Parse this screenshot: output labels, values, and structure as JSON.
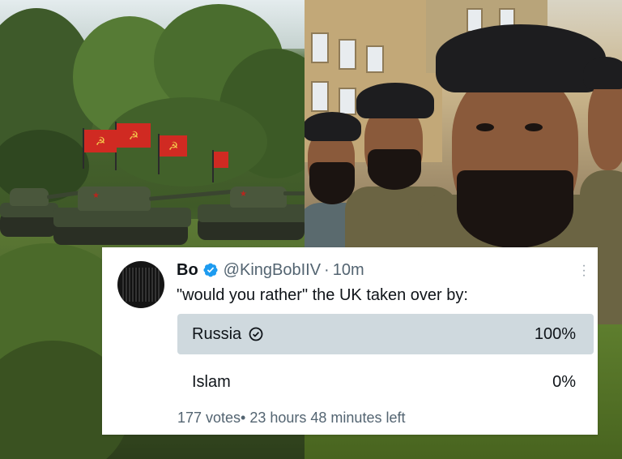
{
  "tweet": {
    "author_name": "Bo",
    "verified_icon": "verified-badge-icon",
    "handle": "@KingBobIIV",
    "separator": "·",
    "time": "10m",
    "text": "\"would you rather\" the UK taken over by:",
    "more_icon": "more-options-icon"
  },
  "poll": {
    "options": [
      {
        "label": "Russia",
        "percent_text": "100%",
        "share": 1.0,
        "winner": true,
        "icon": "check-circle-icon"
      },
      {
        "label": "Islam",
        "percent_text": "0%",
        "share": 0.0,
        "winner": false
      }
    ],
    "footer": "177 votes• 23 hours 48 minutes left"
  },
  "colors": {
    "verified": "#1d9bf0",
    "winner_fill": "#cfd9de",
    "text": "#0f1419",
    "muted": "#536471"
  }
}
